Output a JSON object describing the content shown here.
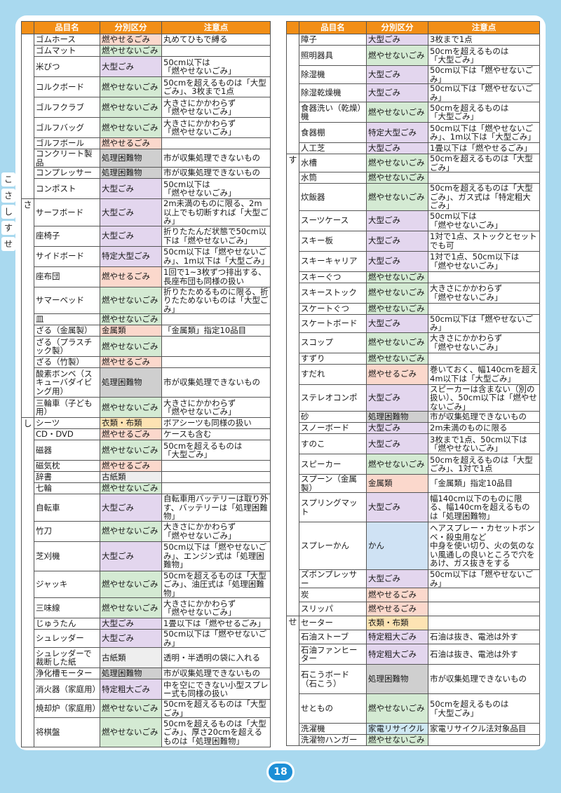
{
  "page_number": "18",
  "side_tabs": [
    "こ",
    "さ",
    "し",
    "す",
    "せ"
  ],
  "headers": {
    "name": "品目名",
    "category": "分別区分",
    "note": "注意点"
  },
  "left": [
    {
      "kana": "",
      "rows": 8,
      "items": [
        {
          "name": "ゴムホース",
          "cat": "燃やせるごみ",
          "cls": "c-moe",
          "note": "丸めてひもで縛る",
          "h": 16
        },
        {
          "name": "ゴムマット",
          "cat": "燃やせないごみ",
          "cls": "c-moenai",
          "note": "",
          "h": 16
        },
        {
          "name": "米びつ",
          "cat": "大型ごみ",
          "cls": "c-ogata",
          "note": "50cm以下は\n「燃やせないごみ」",
          "h": 29
        },
        {
          "name": "コルクボード",
          "cat": "燃やせないごみ",
          "cls": "c-moenai",
          "note": "50cmを超えるものは「大型ごみ」、3枚まで1点",
          "h": 29
        },
        {
          "name": "ゴルフクラブ",
          "cat": "燃やせないごみ",
          "cls": "c-moenai",
          "note": "大きさにかかわらず\n「燃やせないごみ」",
          "h": 29
        },
        {
          "name": "ゴルフバッグ",
          "cat": "燃やせないごみ",
          "cls": "c-moenai",
          "note": "大きさにかかわらず\n「燃やせないごみ」",
          "h": 29
        },
        {
          "name": "ゴルフボール",
          "cat": "燃やせるごみ",
          "cls": "c-moe",
          "note": "",
          "h": 16
        },
        {
          "name": "コンクリート製品",
          "cat": "処理困難物",
          "cls": "c-konnan",
          "note": "市が収集処理できないもの",
          "h": 16
        },
        {
          "name": "コンプレッサー",
          "cat": "処理困難物",
          "cls": "c-konnan",
          "note": "市が収集処理できないもの",
          "h": 16
        },
        {
          "name": "コンポスト",
          "cat": "大型ごみ",
          "cls": "c-ogata",
          "note": "50cm以下は\n「燃やせないごみ」",
          "h": 29
        }
      ]
    },
    {
      "kana": "さ",
      "items": [
        {
          "name": "サーフボード",
          "cat": "大型ごみ",
          "cls": "c-ogata",
          "note": "2m未満のものに限る、2m以上でも切断すれば「大型ごみ」",
          "h": 29
        },
        {
          "name": "座椅子",
          "cat": "大型ごみ",
          "cls": "c-ogata",
          "note": "折りたたんだ状態で50cm以下は「燃やせないごみ」",
          "h": 29
        },
        {
          "name": "サイドボード",
          "cat": "特定大型ごみ",
          "cls": "c-tokutei",
          "note": "50cm以下は「燃やせないごみ」、1m以下は「大型ごみ」",
          "h": 29
        },
        {
          "name": "座布団",
          "cat": "燃やせるごみ",
          "cls": "c-moe",
          "note": "1回で1~3枚ずつ排出する、長座布団も同様の扱い",
          "h": 29
        },
        {
          "name": "サマーベッド",
          "cat": "燃やせないごみ",
          "cls": "c-moenai",
          "note": "折りたためるものに限る、折りたためないものは「大型ごみ」",
          "h": 29
        },
        {
          "name": "皿",
          "cat": "燃やせないごみ",
          "cls": "c-moenai",
          "note": "",
          "h": 16
        },
        {
          "name": "ざる（金属製）",
          "cat": "金属類",
          "cls": "c-kinzoku",
          "note": "「金属類」指定10品目",
          "h": 16
        },
        {
          "name": "ざる（プラスチック製）",
          "cat": "燃やせないごみ",
          "cls": "c-moenai",
          "note": "",
          "h": 29
        },
        {
          "name": "ざる（竹製）",
          "cat": "燃やせるごみ",
          "cls": "c-moe",
          "note": "",
          "h": 16
        },
        {
          "name": "酸素ボンベ（スキューバダイビング用）",
          "cat": "処理困難物",
          "cls": "c-konnan",
          "note": "市が収集処理できないもの",
          "h": 42
        },
        {
          "name": "三輪車（子ども用）",
          "cat": "燃やせないごみ",
          "cls": "c-moenai",
          "note": "大きさにかかわらず\n「燃やせないごみ」",
          "h": 29
        }
      ]
    },
    {
      "kana": "し",
      "items": [
        {
          "name": "シーツ",
          "cat": "衣類・布類",
          "cls": "c-irui",
          "note": "ボアシーツも同様の扱い",
          "h": 16
        },
        {
          "name": "CD・DVD",
          "cat": "燃やせるごみ",
          "cls": "c-moe",
          "note": "ケースも含む",
          "h": 16
        },
        {
          "name": "磁器",
          "cat": "燃やせないごみ",
          "cls": "c-moenai",
          "note": "50cmを超えるものは\n「大型ごみ」",
          "h": 29
        },
        {
          "name": "磁気枕",
          "cat": "燃やせるごみ",
          "cls": "c-moe",
          "note": "",
          "h": 16
        },
        {
          "name": "辞書",
          "cat": "古紙類",
          "cls": "c-koshi",
          "note": "",
          "h": 16
        },
        {
          "name": "七輪",
          "cat": "燃やせないごみ",
          "cls": "c-moenai",
          "note": "",
          "h": 16
        },
        {
          "name": "自転車",
          "cat": "大型ごみ",
          "cls": "c-ogata",
          "note": "自転車用バッテリーは取り外す、バッテリーは「処理困難物」",
          "h": 29
        },
        {
          "name": "竹刀",
          "cat": "燃やせないごみ",
          "cls": "c-moenai",
          "note": "大きさにかかわらず\n「燃やせないごみ」",
          "h": 29
        },
        {
          "name": "芝刈機",
          "cat": "大型ごみ",
          "cls": "c-ogata",
          "note": "50cm以下は「燃やせないごみ」、エンジン式は「処理困難物」",
          "h": 42
        },
        {
          "name": "ジャッキ",
          "cat": "燃やせないごみ",
          "cls": "c-moenai",
          "note": "50cmを超えるものは「大型ごみ」、油圧式は「処理困難物」",
          "h": 29
        },
        {
          "name": "三味線",
          "cat": "燃やせないごみ",
          "cls": "c-moenai",
          "note": "大きさにかかわらず\n「燃やせないごみ」",
          "h": 29
        },
        {
          "name": "じゅうたん",
          "cat": "大型ごみ",
          "cls": "c-ogata",
          "note": "1畳以下は「燃やせるごみ」",
          "h": 16
        },
        {
          "name": "シュレッダー",
          "cat": "大型ごみ",
          "cls": "c-ogata",
          "note": "50cm以下は「燃やせないごみ」",
          "h": 16
        },
        {
          "name": "シュレッダーで裁断した紙",
          "cat": "古紙類",
          "cls": "c-koshi",
          "note": "透明・半透明の袋に入れる",
          "h": 29
        },
        {
          "name": "浄化槽モーター",
          "cat": "処理困難物",
          "cls": "c-konnan",
          "note": "市が収集処理できないもの",
          "h": 16
        },
        {
          "name": "消火器（家庭用）",
          "cat": "特定粗大ごみ",
          "cls": "c-tokutei",
          "note": "中を空にできない小型スプレー式も同様の扱い",
          "h": 29
        },
        {
          "name": "焼却炉（家庭用）",
          "cat": "燃やせないごみ",
          "cls": "c-moenai",
          "note": "50cmを超えるものは「大型ごみ」",
          "h": 16
        },
        {
          "name": "将棋盤",
          "cat": "燃やせないごみ",
          "cls": "c-moenai",
          "note": "50cmを超えるものは「大型ごみ」、厚さ20cmを超えるものは「処理困難物」",
          "h": 42
        }
      ]
    }
  ],
  "right": [
    {
      "kana": "",
      "items": [
        {
          "name": "障子",
          "cat": "大型ごみ",
          "cls": "c-ogata",
          "note": "3枚まで1点",
          "h": 16
        },
        {
          "name": "照明器具",
          "cat": "燃やせないごみ",
          "cls": "c-moenai",
          "note": "50cmを超えるものは\n「大型ごみ」",
          "h": 29
        },
        {
          "name": "除湿機",
          "cat": "大型ごみ",
          "cls": "c-ogata",
          "note": "50cm以下は「燃やせないごみ」",
          "h": 16
        },
        {
          "name": "除湿乾燥機",
          "cat": "大型ごみ",
          "cls": "c-ogata",
          "note": "50cm以下は「燃やせないごみ」",
          "h": 16
        },
        {
          "name": "食器洗い（乾燥）機",
          "cat": "燃やせないごみ",
          "cls": "c-moenai",
          "note": "50cmを超えるものは\n「大型ごみ」",
          "h": 29
        },
        {
          "name": "食器棚",
          "cat": "特定大型ごみ",
          "cls": "c-tokutei",
          "note": "50cm以下は「燃やせないごみ」、1m以下は「大型ごみ」",
          "h": 29
        },
        {
          "name": "人工芝",
          "cat": "大型ごみ",
          "cls": "c-ogata",
          "note": "1畳以下は「燃やせるごみ」",
          "h": 16
        }
      ]
    },
    {
      "kana": "す",
      "items": [
        {
          "name": "水槽",
          "cat": "燃やせないごみ",
          "cls": "c-moenai",
          "note": "50cmを超えるものは「大型ごみ」",
          "h": 16
        },
        {
          "name": "水筒",
          "cat": "燃やせないごみ",
          "cls": "c-moenai",
          "note": "",
          "h": 16
        },
        {
          "name": "炊飯器",
          "cat": "燃やせないごみ",
          "cls": "c-moenai",
          "note": "50cmを超えるものは「大型ごみ」、ガス式は「特定粗大ごみ」",
          "h": 29
        },
        {
          "name": "スーツケース",
          "cat": "大型ごみ",
          "cls": "c-ogata",
          "note": "50cm以下は\n「燃やせないごみ」",
          "h": 29
        },
        {
          "name": "スキー板",
          "cat": "大型ごみ",
          "cls": "c-ogata",
          "note": "1対で1点、ストックとセットでも可",
          "h": 29
        },
        {
          "name": "スキーキャリア",
          "cat": "大型ごみ",
          "cls": "c-ogata",
          "note": "1対で1点、50cm以下は\n「燃やせないごみ」",
          "h": 29
        },
        {
          "name": "スキーぐつ",
          "cat": "燃やせないごみ",
          "cls": "c-moenai",
          "note": "",
          "h": 16
        },
        {
          "name": "スキーストック",
          "cat": "燃やせないごみ",
          "cls": "c-moenai",
          "note": "大きさにかかわらず\n「燃やせないごみ」",
          "h": 29
        },
        {
          "name": "スケートぐつ",
          "cat": "燃やせないごみ",
          "cls": "c-moenai",
          "note": "",
          "h": 16
        },
        {
          "name": "スケートボード",
          "cat": "大型ごみ",
          "cls": "c-ogata",
          "note": "50cm以下は「燃やせないごみ」",
          "h": 16
        },
        {
          "name": "スコップ",
          "cat": "燃やせないごみ",
          "cls": "c-moenai",
          "note": "大きさにかかわらず\n「燃やせないごみ」",
          "h": 29
        },
        {
          "name": "すずり",
          "cat": "燃やせないごみ",
          "cls": "c-moenai",
          "note": "",
          "h": 16
        },
        {
          "name": "すだれ",
          "cat": "燃やせるごみ",
          "cls": "c-moe",
          "note": "巻いておく、幅140cmを超え4m以下は「大型ごみ」",
          "h": 29
        },
        {
          "name": "ステレオコンポ",
          "cat": "大型ごみ",
          "cls": "c-ogata",
          "note": "スピーカーは含まない（別の扱い）、50cm以下は「燃やせないごみ」",
          "h": 29
        },
        {
          "name": "砂",
          "cat": "処理困難物",
          "cls": "c-konnan",
          "note": "市が収集処理できないもの",
          "h": 16
        },
        {
          "name": "スノーボード",
          "cat": "大型ごみ",
          "cls": "c-ogata",
          "note": "2m未満のものに限る",
          "h": 16
        },
        {
          "name": "すのこ",
          "cat": "大型ごみ",
          "cls": "c-ogata",
          "note": "3枚まで1点、50cm以下は\n「燃やせないごみ」",
          "h": 29
        },
        {
          "name": "スピーカー",
          "cat": "燃やせないごみ",
          "cls": "c-moenai",
          "note": "50cmを超えるものは「大型ごみ」、1対で1点",
          "h": 29
        },
        {
          "name": "スプーン（金属製）",
          "cat": "金属類",
          "cls": "c-kinzoku",
          "note": "「金属類」指定10品目",
          "h": 16
        },
        {
          "name": "スプリングマット",
          "cat": "大型ごみ",
          "cls": "c-ogata",
          "note": "幅140cm以下のものに限る、幅140cmを超えるものは「処理困難物」",
          "h": 42
        },
        {
          "name": "スプレーかん",
          "cat": "かん",
          "cls": "c-kan",
          "note": "ヘアスプレー・カセットボンベ・殺虫用など\n中身を使い切り、火の気のない風通しの良いところで穴をあけ、ガス抜きをする",
          "h": 68
        },
        {
          "name": "ズボンプレッサー",
          "cat": "大型ごみ",
          "cls": "c-ogata",
          "note": "50cm以下は「燃やせないごみ」",
          "h": 16
        },
        {
          "name": "炭",
          "cat": "燃やせるごみ",
          "cls": "c-moe",
          "note": "",
          "h": 20
        },
        {
          "name": "スリッパ",
          "cat": "燃やせるごみ",
          "cls": "c-moe",
          "note": "",
          "h": 20
        }
      ]
    },
    {
      "kana": "せ",
      "items": [
        {
          "name": "セーター",
          "cat": "衣類・布類",
          "cls": "c-irui",
          "note": "",
          "h": 20
        },
        {
          "name": "石油ストーブ",
          "cat": "特定粗大ごみ",
          "cls": "c-tokutei",
          "note": "石油は抜き、電池は外す",
          "h": 20
        },
        {
          "name": "石油ファンヒーター",
          "cat": "特定粗大ごみ",
          "cls": "c-tokutei",
          "note": "石油は抜き、電池は外す",
          "h": 29
        },
        {
          "name": "石こうボード（石こう）",
          "cat": "処理困難物",
          "cls": "c-konnan",
          "note": "市が収集処理できないもの",
          "h": 42
        },
        {
          "name": "せともの",
          "cat": "燃やせないごみ",
          "cls": "c-moenai",
          "note": "50cmを超えるものは\n「大型ごみ」",
          "h": 42
        },
        {
          "name": "洗濯機",
          "cat": "家電リサイクル",
          "cls": "c-kaden",
          "note": "家電リサイクル法対象品目",
          "h": 16
        },
        {
          "name": "洗濯物ハンガー",
          "cat": "燃やせないごみ",
          "cls": "c-moenai",
          "note": "",
          "h": 16
        }
      ]
    }
  ]
}
